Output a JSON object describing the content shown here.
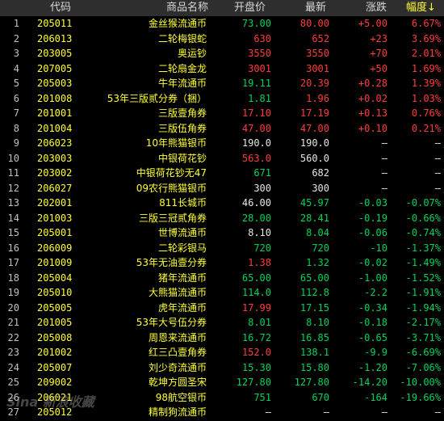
{
  "header": {
    "code": "代码",
    "name": "商品名称",
    "open": "开盘价",
    "last": "最新",
    "change": "涨跌",
    "pct": "幅度↓"
  },
  "colors": {
    "up": "#ff3c3c",
    "down": "#00d25a",
    "flat": "#e6e6e6",
    "code": "#ffff33"
  },
  "rows": [
    {
      "idx": "1",
      "code": "205011",
      "name": "金丝猴流通币",
      "open": "73.00",
      "last": "80.00",
      "change": "+5.00",
      "pct": "6.67%",
      "oc": "green",
      "lc": "red",
      "cc": "red"
    },
    {
      "idx": "2",
      "code": "206013",
      "name": "二轮梅银蛇",
      "open": "630",
      "last": "652",
      "change": "+23",
      "pct": "3.69%",
      "oc": "red",
      "lc": "red",
      "cc": "red"
    },
    {
      "idx": "3",
      "code": "203005",
      "name": "奥运钞",
      "open": "3550",
      "last": "3550",
      "change": "+70",
      "pct": "2.01%",
      "oc": "red",
      "lc": "red",
      "cc": "red"
    },
    {
      "idx": "4",
      "code": "207005",
      "name": "二轮扇金龙",
      "open": "3001",
      "last": "3001",
      "change": "+50",
      "pct": "1.69%",
      "oc": "red",
      "lc": "red",
      "cc": "red"
    },
    {
      "idx": "5",
      "code": "205003",
      "name": "牛年流通币",
      "open": "19.11",
      "last": "20.39",
      "change": "+0.28",
      "pct": "1.39%",
      "oc": "green",
      "lc": "red",
      "cc": "red"
    },
    {
      "idx": "6",
      "code": "201008",
      "name": "53年三版贰分券（捆）",
      "open": "1.81",
      "last": "1.96",
      "change": "+0.02",
      "pct": "1.03%",
      "oc": "green",
      "lc": "red",
      "cc": "red"
    },
    {
      "idx": "7",
      "code": "201001",
      "name": "三版壹角券",
      "open": "17.10",
      "last": "17.19",
      "change": "+0.13",
      "pct": "0.76%",
      "oc": "red",
      "lc": "red",
      "cc": "red"
    },
    {
      "idx": "8",
      "code": "201004",
      "name": "三版伍角券",
      "open": "47.00",
      "last": "47.00",
      "change": "+0.10",
      "pct": "0.21%",
      "oc": "red",
      "lc": "red",
      "cc": "red"
    },
    {
      "idx": "9",
      "code": "206023",
      "name": "10年熊猫银币",
      "open": "190.0",
      "last": "190.0",
      "change": "—",
      "pct": "—",
      "oc": "white",
      "lc": "white",
      "cc": "white"
    },
    {
      "idx": "10",
      "code": "203003",
      "name": "中银荷花钞",
      "open": "563.0",
      "last": "560.0",
      "change": "—",
      "pct": "—",
      "oc": "red",
      "lc": "white",
      "cc": "white"
    },
    {
      "idx": "11",
      "code": "203002",
      "name": "中银荷花钞无47",
      "open": "671",
      "last": "682",
      "change": "—",
      "pct": "—",
      "oc": "green",
      "lc": "white",
      "cc": "white"
    },
    {
      "idx": "12",
      "code": "206027",
      "name": "09农行熊猫银币",
      "open": "300",
      "last": "300",
      "change": "—",
      "pct": "—",
      "oc": "white",
      "lc": "white",
      "cc": "white"
    },
    {
      "idx": "13",
      "code": "202001",
      "name": "811长城币",
      "open": "46.00",
      "last": "45.97",
      "change": "-0.03",
      "pct": "-0.07%",
      "oc": "white",
      "lc": "green",
      "cc": "green"
    },
    {
      "idx": "14",
      "code": "201003",
      "name": "三版三冠贰角券",
      "open": "28.00",
      "last": "28.41",
      "change": "-0.19",
      "pct": "-0.66%",
      "oc": "green",
      "lc": "green",
      "cc": "green"
    },
    {
      "idx": "15",
      "code": "205001",
      "name": "世博流通币",
      "open": "8.10",
      "last": "8.04",
      "change": "-0.06",
      "pct": "-0.74%",
      "oc": "white",
      "lc": "green",
      "cc": "green"
    },
    {
      "idx": "16",
      "code": "206009",
      "name": "二轮彩银马",
      "open": "720",
      "last": "720",
      "change": "-10",
      "pct": "-1.37%",
      "oc": "green",
      "lc": "green",
      "cc": "green"
    },
    {
      "idx": "17",
      "code": "201009",
      "name": "53年无油壹分券",
      "open": "1.38",
      "last": "1.32",
      "change": "-0.02",
      "pct": "-1.49%",
      "oc": "red",
      "lc": "green",
      "cc": "green"
    },
    {
      "idx": "18",
      "code": "205004",
      "name": "猪年流通币",
      "open": "65.00",
      "last": "65.00",
      "change": "-1.00",
      "pct": "-1.52%",
      "oc": "green",
      "lc": "green",
      "cc": "green"
    },
    {
      "idx": "19",
      "code": "205010",
      "name": "大熊猫流通币",
      "open": "114.0",
      "last": "112.8",
      "change": "-2.2",
      "pct": "-1.91%",
      "oc": "green",
      "lc": "green",
      "cc": "green"
    },
    {
      "idx": "20",
      "code": "205005",
      "name": "虎年流通币",
      "open": "17.99",
      "last": "17.15",
      "change": "-0.34",
      "pct": "-1.94%",
      "oc": "red",
      "lc": "green",
      "cc": "green"
    },
    {
      "idx": "21",
      "code": "201005",
      "name": "53年大号伍分券",
      "open": "8.01",
      "last": "8.10",
      "change": "-0.18",
      "pct": "-2.17%",
      "oc": "green",
      "lc": "green",
      "cc": "green"
    },
    {
      "idx": "22",
      "code": "205008",
      "name": "周恩来流通币",
      "open": "16.72",
      "last": "16.85",
      "change": "-0.65",
      "pct": "-3.71%",
      "oc": "green",
      "lc": "green",
      "cc": "green"
    },
    {
      "idx": "23",
      "code": "201002",
      "name": "红三凸壹角券",
      "open": "152.0",
      "last": "138.1",
      "change": "-9.9",
      "pct": "-6.69%",
      "oc": "red",
      "lc": "green",
      "cc": "green"
    },
    {
      "idx": "24",
      "code": "205007",
      "name": "刘少奇流通币",
      "open": "15.30",
      "last": "15.80",
      "change": "-1.20",
      "pct": "-7.06%",
      "oc": "green",
      "lc": "green",
      "cc": "green"
    },
    {
      "idx": "25",
      "code": "209002",
      "name": "乾坤方圆圣宋",
      "open": "127.80",
      "last": "127.80",
      "change": "-14.20",
      "pct": "-10.00%",
      "oc": "green",
      "lc": "green",
      "cc": "green"
    },
    {
      "idx": "26",
      "code": "206021",
      "name": "98航空银币",
      "open": "751",
      "last": "670",
      "change": "-164",
      "pct": "-19.66%",
      "oc": "green",
      "lc": "green",
      "cc": "green"
    },
    {
      "idx": "27",
      "code": "205012",
      "name": "精制狗流通币",
      "open": "—",
      "last": "—",
      "change": "—",
      "pct": "—",
      "oc": "white",
      "lc": "white",
      "cc": "white"
    }
  ],
  "watermark": "Sina 新浪收藏"
}
